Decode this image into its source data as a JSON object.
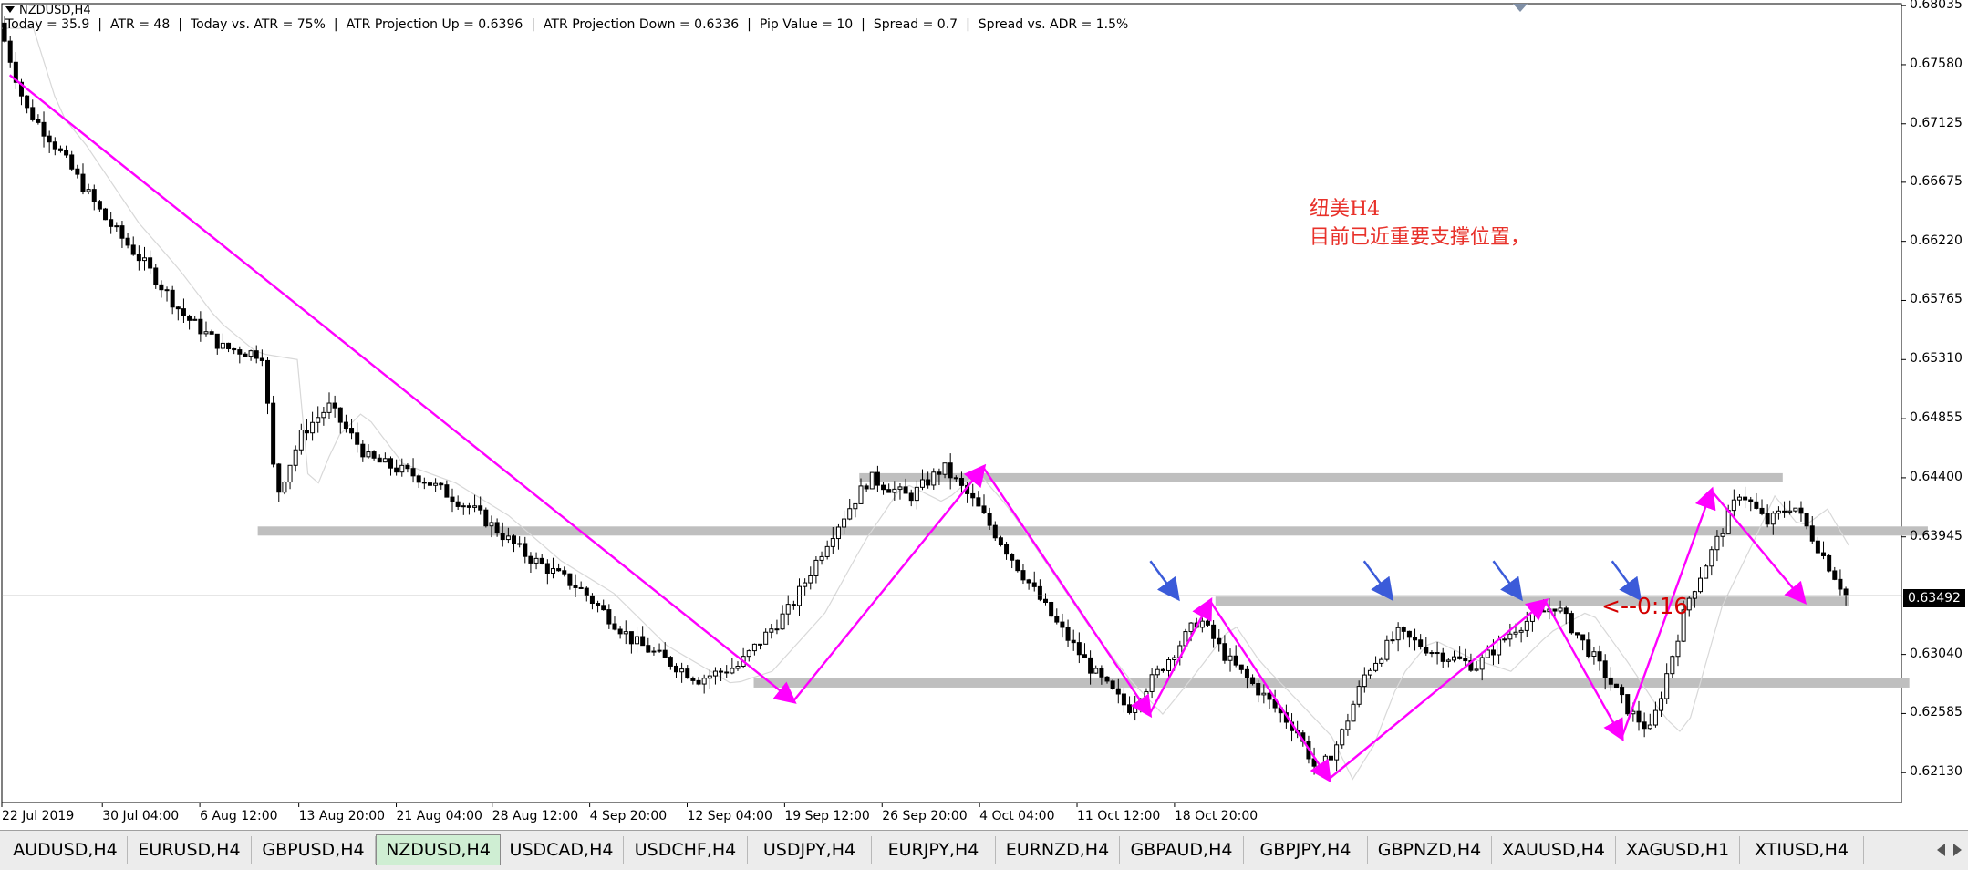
{
  "window": {
    "symbol_title": "NZDUSD,H4"
  },
  "info_bar": [
    "Today = 35.9",
    "ATR = 48",
    "Today vs. ATR = 75%",
    "ATR Projection Up = 0.6396",
    "ATR Projection Down = 0.6336",
    "Pip Value = 10",
    "Spread = 0.7",
    "Spread vs. ADR = 1.5%"
  ],
  "annotation": {
    "line1": "纽美H4",
    "line2": "目前已近重要支撑位置，"
  },
  "countdown": "<--0:16",
  "current_price": "0.63492",
  "colors": {
    "candle": "#000000",
    "trend_line": "#ff00ff",
    "level_band": "#bfbfbf",
    "arrow": "#3b5bd9",
    "annotation": "#e8312a",
    "active_tab": "#cfeed3"
  },
  "chart_data": {
    "type": "candlestick",
    "symbol": "NZDUSD",
    "timeframe": "H4",
    "ylim": [
      0.619,
      0.6805
    ],
    "y_ticks": [
      "0.68035",
      "0.67580",
      "0.67125",
      "0.66675",
      "0.66220",
      "0.65765",
      "0.65310",
      "0.64855",
      "0.64400",
      "0.63945",
      "0.63490",
      "0.63040",
      "0.62585",
      "0.62130"
    ],
    "x_tick_labels": [
      "22 Jul 2019",
      "30 Jul 04:00",
      "6 Aug 12:00",
      "13 Aug 20:00",
      "21 Aug 04:00",
      "28 Aug 12:00",
      "4 Sep 20:00",
      "12 Sep 04:00",
      "19 Sep 12:00",
      "26 Sep 20:00",
      "4 Oct 04:00",
      "11 Oct 12:00",
      "18 Oct 20:00"
    ],
    "bar_count": 330,
    "price_path": [
      [
        0,
        0.679
      ],
      [
        10,
        0.6725
      ],
      [
        20,
        0.67
      ],
      [
        30,
        0.667
      ],
      [
        40,
        0.664
      ],
      [
        55,
        0.6605
      ],
      [
        70,
        0.6565
      ],
      [
        85,
        0.654
      ],
      [
        100,
        0.6535
      ],
      [
        105,
        0.6425
      ],
      [
        115,
        0.6475
      ],
      [
        125,
        0.6495
      ],
      [
        140,
        0.6455
      ],
      [
        160,
        0.644
      ],
      [
        180,
        0.6415
      ],
      [
        200,
        0.638
      ],
      [
        220,
        0.6355
      ],
      [
        240,
        0.6315
      ],
      [
        265,
        0.6285
      ],
      [
        280,
        0.6295
      ],
      [
        300,
        0.634
      ],
      [
        315,
        0.6395
      ],
      [
        330,
        0.644
      ],
      [
        345,
        0.6425
      ],
      [
        358,
        0.6448
      ],
      [
        370,
        0.642
      ],
      [
        385,
        0.6375
      ],
      [
        400,
        0.633
      ],
      [
        415,
        0.629
      ],
      [
        428,
        0.6262
      ],
      [
        440,
        0.6292
      ],
      [
        455,
        0.6332
      ],
      [
        465,
        0.6302
      ],
      [
        478,
        0.6275
      ],
      [
        492,
        0.6245
      ],
      [
        500,
        0.6212
      ],
      [
        508,
        0.6238
      ],
      [
        518,
        0.629
      ],
      [
        530,
        0.632
      ],
      [
        545,
        0.6305
      ],
      [
        560,
        0.6295
      ],
      [
        575,
        0.6325
      ],
      [
        590,
        0.6342
      ],
      [
        605,
        0.63
      ],
      [
        618,
        0.626
      ],
      [
        626,
        0.6245
      ],
      [
        640,
        0.6345
      ],
      [
        652,
        0.6395
      ],
      [
        660,
        0.643
      ],
      [
        670,
        0.6405
      ],
      [
        680,
        0.642
      ],
      [
        690,
        0.6385
      ],
      [
        700,
        0.635
      ]
    ],
    "price_lines": [
      {
        "price": 0.644,
        "from_bar": 325,
        "to_bar": 675
      },
      {
        "price": 0.6399,
        "from_bar": 97,
        "to_bar": 730
      },
      {
        "price": 0.6345,
        "from_bar": 460,
        "to_bar": 700
      },
      {
        "price": 0.6282,
        "from_bar": 285,
        "to_bar": 723
      }
    ],
    "trend_lines": [
      {
        "from": [
          3,
          0.675
        ],
        "to": [
          300,
          0.6268
        ]
      },
      {
        "from": [
          300,
          0.6268
        ],
        "to": [
          372,
          0.6448
        ]
      },
      {
        "from": [
          372,
          0.6448
        ],
        "to": [
          435,
          0.6258
        ]
      },
      {
        "from": [
          435,
          0.6258
        ],
        "to": [
          458,
          0.6345
        ]
      },
      {
        "from": [
          458,
          0.6345
        ],
        "to": [
          503,
          0.6208
        ]
      },
      {
        "from": [
          503,
          0.6208
        ],
        "to": [
          585,
          0.6345
        ]
      },
      {
        "from": [
          585,
          0.6345
        ],
        "to": [
          614,
          0.624
        ]
      },
      {
        "from": [
          614,
          0.624
        ],
        "to": [
          648,
          0.643
        ]
      },
      {
        "from": [
          648,
          0.643
        ],
        "to": [
          683,
          0.6345
        ]
      }
    ],
    "arrows": [
      445,
      526,
      575,
      620
    ]
  },
  "tabs": [
    {
      "label": "AUDUSD,H4"
    },
    {
      "label": "EURUSD,H4"
    },
    {
      "label": "GBPUSD,H4"
    },
    {
      "label": "NZDUSD,H4",
      "active": true
    },
    {
      "label": "USDCAD,H4"
    },
    {
      "label": "USDCHF,H4"
    },
    {
      "label": "USDJPY,H4"
    },
    {
      "label": "EURJPY,H4"
    },
    {
      "label": "EURNZD,H4"
    },
    {
      "label": "GBPAUD,H4"
    },
    {
      "label": "GBPJPY,H4"
    },
    {
      "label": "GBPNZD,H4"
    },
    {
      "label": "XAUUSD,H4"
    },
    {
      "label": "XAGUSD,H1"
    },
    {
      "label": "XTIUSD,H4"
    }
  ]
}
